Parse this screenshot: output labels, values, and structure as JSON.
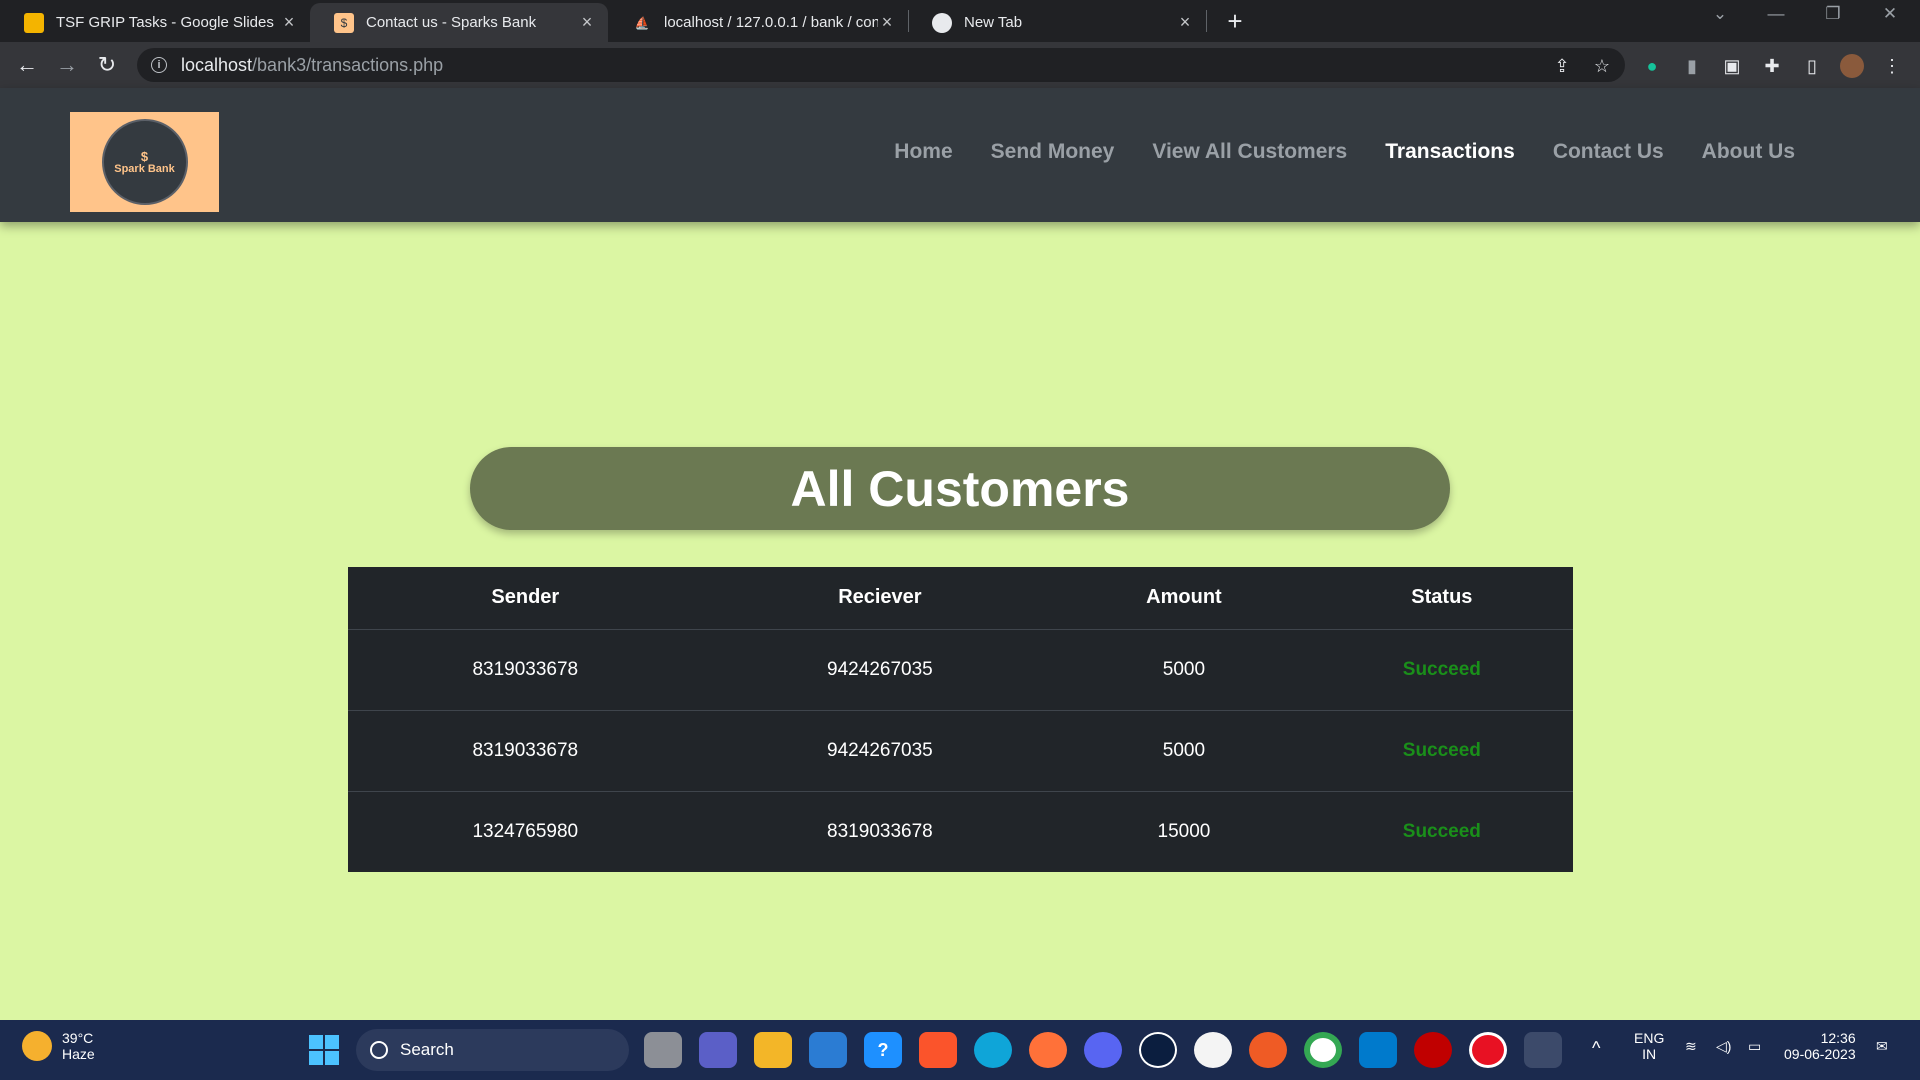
{
  "browser": {
    "tabs": [
      {
        "title": "TSF GRIP Tasks - Google Slides",
        "icon": "slides-icon"
      },
      {
        "title": "Contact us - Sparks Bank",
        "icon": "site-icon"
      },
      {
        "title": "localhost / 127.0.0.1 / bank / con",
        "icon": "phpmyadmin-icon"
      },
      {
        "title": "New Tab",
        "icon": "chrome-icon"
      }
    ],
    "url_host": "localhost",
    "url_path": "/bank3/transactions.php"
  },
  "site": {
    "logo_symbol": "$",
    "logo_name": "Spark Bank",
    "nav": [
      "Home",
      "Send Money",
      "View All Customers",
      "Transactions",
      "Contact Us",
      "About Us"
    ],
    "active_nav": "Transactions",
    "heading": "All Customers",
    "table": {
      "headers": [
        "Sender",
        "Reciever",
        "Amount",
        "Status"
      ],
      "rows": [
        [
          "8319033678",
          "9424267035",
          "5000",
          "Succeed"
        ],
        [
          "8319033678",
          "9424267035",
          "5000",
          "Succeed"
        ],
        [
          "1324765980",
          "8319033678",
          "15000",
          "Succeed"
        ]
      ]
    }
  },
  "taskbar": {
    "temperature": "39°C",
    "weather": "Haze",
    "search_label": "Search",
    "lang_line1": "ENG",
    "lang_line2": "IN",
    "time": "12:36",
    "date": "09-06-2023"
  },
  "colors": {
    "page_bg": "#dbf6a3",
    "navbar_bg": "#343a40",
    "heading_bg": "#6b7952",
    "table_bg": "#212529",
    "status_success": "#1a8f1a",
    "logo_bg": "#ffc48a"
  }
}
